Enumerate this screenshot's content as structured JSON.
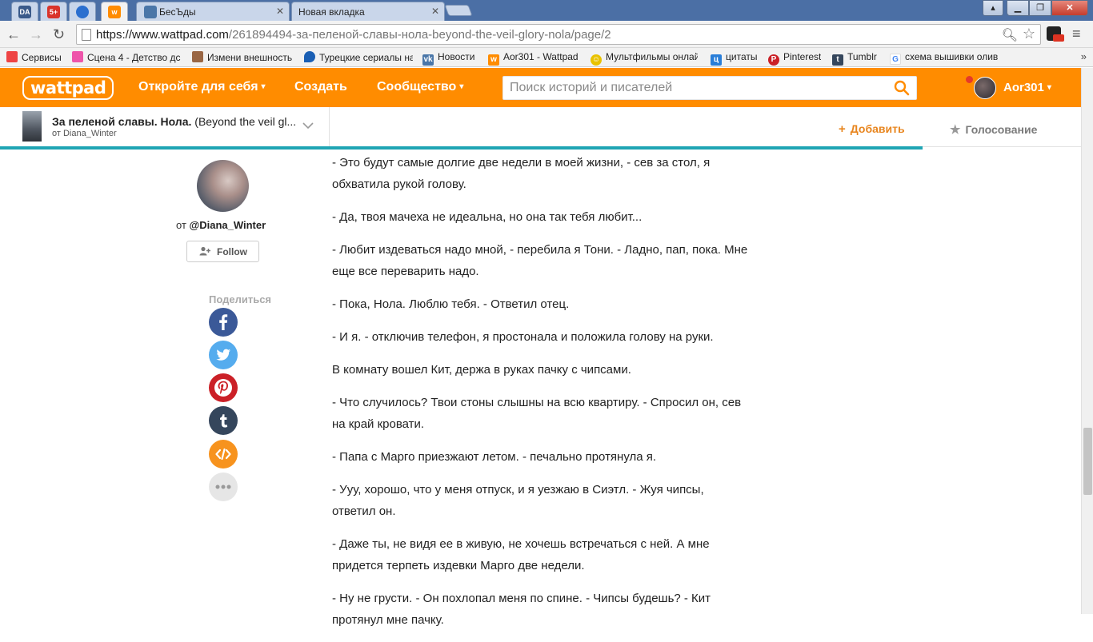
{
  "browser": {
    "tabs": [
      {
        "title": "DA",
        "pinned": true,
        "color": "#3a5a8a"
      },
      {
        "title": "5+",
        "pinned": true,
        "color": "#d9342a"
      },
      {
        "title": "",
        "pinned": true,
        "color": "#2b6fcf"
      },
      {
        "title": "",
        "pinned": true,
        "color": "#ff8c00",
        "active": true
      },
      {
        "title": "БесЪды",
        "pinned": false,
        "color": "#4a76a8"
      },
      {
        "title": "Новая вкладка",
        "pinned": false,
        "color": "#ffffff"
      }
    ],
    "url_host": "https://www.wattpad.com",
    "url_path": "/261894494-за-пеленой-славы-нола-beyond-the-veil-glory-nola/page/2",
    "bookmarks": [
      {
        "label": "Сервисы",
        "icon": "apps-grid-icon",
        "color": "#e44"
      },
      {
        "label": "Сцена 4 - Детство дс",
        "icon": "heart-icon",
        "color": "#e5a"
      },
      {
        "label": "Измени внешность",
        "icon": "cake-icon",
        "color": "#964"
      },
      {
        "label": "Турецкие сериалы на",
        "icon": "drop-icon",
        "color": "#1a5fb4"
      },
      {
        "label": "Новости",
        "icon": "vk-icon",
        "color": "#4a76a8"
      },
      {
        "label": "Aor301 - Wattpad",
        "icon": "wattpad-icon",
        "color": "#ff8c00"
      },
      {
        "label": "Мультфильмы онлай",
        "icon": "smile-icon",
        "color": "#e9c200"
      },
      {
        "label": "цитаты",
        "icon": "q-icon",
        "color": "#2a7ed8"
      },
      {
        "label": "Pinterest",
        "icon": "pinterest-icon",
        "color": "#cb2027"
      },
      {
        "label": "Tumblr",
        "icon": "tumblr-icon",
        "color": "#35465c"
      },
      {
        "label": "схема вышивки олив",
        "icon": "google-icon",
        "color": "#4285f4"
      }
    ]
  },
  "wattpad": {
    "logo": "wattpad",
    "nav": {
      "discover": "Откройте для себя",
      "create": "Создать",
      "community": "Сообщество"
    },
    "search_placeholder": "Поиск историй и писателей",
    "username": "Aor301",
    "brand_color": "#ff8c00"
  },
  "story": {
    "title_bold": "За пеленой славы. Нола.",
    "title_rest": " (Beyond the veil gl...",
    "author_line": "от Diana_Winter",
    "add_label": "Добавить",
    "vote_label": "Голосование",
    "reading_progress": 0.844
  },
  "author": {
    "prefix": "от",
    "handle": "@Diana_Winter",
    "follow_label": "Follow",
    "share_label": "Поделиться",
    "share_buttons": [
      {
        "name": "facebook",
        "color": "#3b5998"
      },
      {
        "name": "twitter",
        "color": "#55acee"
      },
      {
        "name": "pinterest",
        "color": "#cb2027"
      },
      {
        "name": "tumblr",
        "color": "#35465c"
      },
      {
        "name": "embed",
        "color": "#f7931e"
      },
      {
        "name": "more",
        "color": "#e6e6e6"
      }
    ]
  },
  "paragraphs": [
    "- Это будут самые долгие две недели в моей жизни, - сев за стол, я обхватила рукой голову.",
    "- Да, твоя мачеха не идеальна, но она так тебя любит...",
    "- Любит издеваться надо мной, - перебила я Тони. - Ладно, пап, пока. Мне еще все переварить надо.",
    "- Пока, Нола. Люблю тебя. - Ответил отец.",
    "- И я. - отключив телефон, я простонала и положила голову на руки.",
    "В комнату вошел Кит, держа в руках пачку с чипсами.",
    "- Что случилось? Твои стоны слышны на всю квартиру. - Спросил он, сев на край кровати.",
    "- Папа с Марго приезжают летом. - печально протянула я.",
    "- Ууу, хорошо, что у меня отпуск, и я уезжаю в Сиэтл. - Жуя чипсы, ответил он.",
    "- Даже ты, не видя ее в живую, не хочешь встречаться с ней. А мне придется терпеть издевки Марго две недели.",
    "- Ну не грусти. - Он похлопал меня по спине. - Чипсы будешь? - Кит протянул мне пачку."
  ]
}
